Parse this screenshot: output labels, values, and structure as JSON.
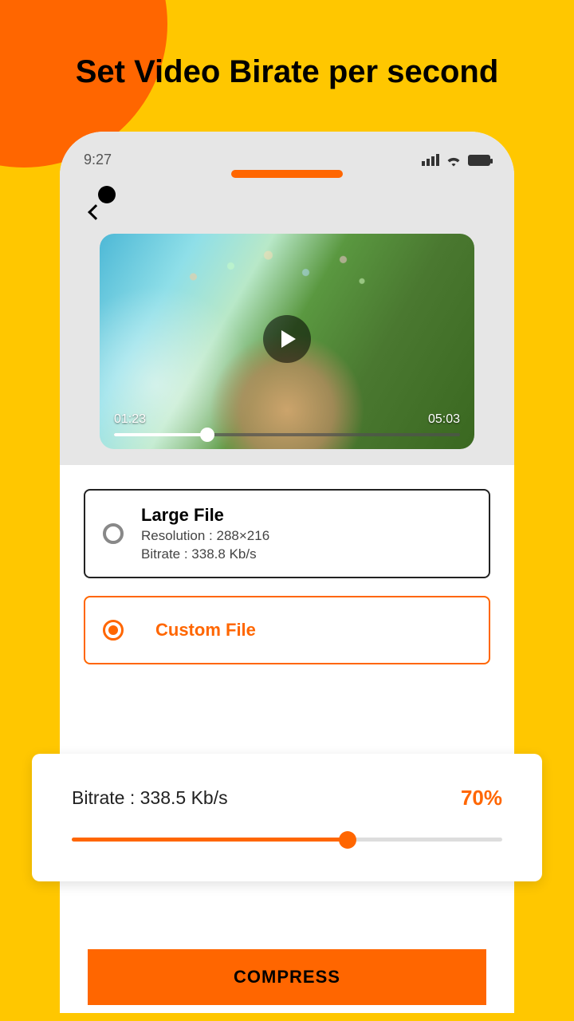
{
  "page": {
    "title": "Set Video Birate per second"
  },
  "status": {
    "time": "9:27"
  },
  "video": {
    "current_time": "01:23",
    "duration": "05:03"
  },
  "options": {
    "large": {
      "title": "Large File",
      "resolution": "Resolution : 288×216",
      "bitrate": "Bitrate : 338.8 Kb/s"
    },
    "custom": {
      "title": "Custom File"
    }
  },
  "bitrate_panel": {
    "label": "Bitrate : 338.5 Kb/s",
    "percent": "70%"
  },
  "actions": {
    "compress": "COMPRESS"
  }
}
